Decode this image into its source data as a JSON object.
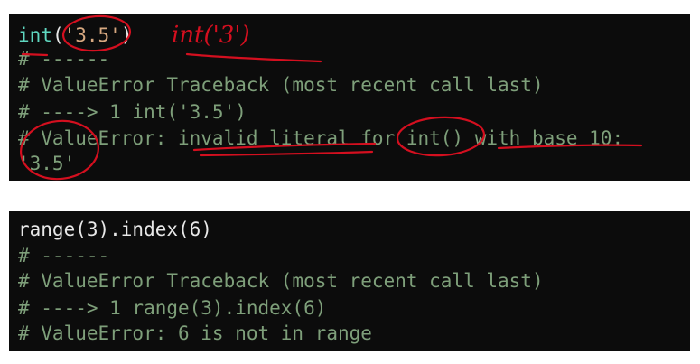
{
  "block1": {
    "line1": {
      "func": "int",
      "open": "(",
      "arg": "'3.5'",
      "close": ")"
    },
    "line2": "# ------",
    "line3": "# ValueError Traceback (most recent call last)",
    "line4": "# ----> 1 int('3.5')",
    "line5": "# ValueError: invalid literal for int() with base 10:",
    "line6": "'3.5'"
  },
  "block2": {
    "line1": "range(3).index(6)",
    "line2": "# ------",
    "line3": "# ValueError Traceback (most recent call last)",
    "line4": "# ----> 1 range(3).index(6)",
    "line5": "# ValueError: 6 is not in range"
  },
  "annotation": {
    "handwritten": "int('3')",
    "ink_color": "#d40f1f"
  }
}
